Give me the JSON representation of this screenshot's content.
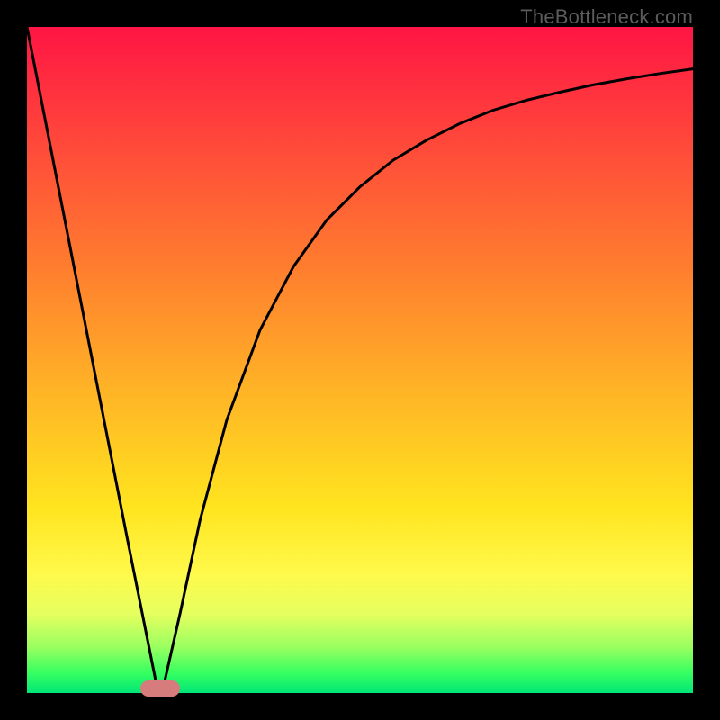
{
  "watermark": "TheBottleneck.com",
  "chart_data": {
    "type": "line",
    "title": "",
    "xlabel": "",
    "ylabel": "",
    "xlim": [
      0,
      1
    ],
    "ylim": [
      0,
      1
    ],
    "grid": false,
    "legend": false,
    "background_gradient": {
      "direction": "vertical",
      "stops": [
        {
          "pos": 0.0,
          "color": "#ff1544"
        },
        {
          "pos": 0.18,
          "color": "#ff4a3a"
        },
        {
          "pos": 0.35,
          "color": "#ff7a2f"
        },
        {
          "pos": 0.55,
          "color": "#ffb526"
        },
        {
          "pos": 0.72,
          "color": "#ffe41f"
        },
        {
          "pos": 0.82,
          "color": "#fff94a"
        },
        {
          "pos": 0.88,
          "color": "#e6ff5f"
        },
        {
          "pos": 0.93,
          "color": "#9cff60"
        },
        {
          "pos": 0.97,
          "color": "#36ff60"
        },
        {
          "pos": 1.0,
          "color": "#00e676"
        }
      ]
    },
    "series": [
      {
        "name": "bottleneck-curve",
        "x": [
          0.0,
          0.05,
          0.1,
          0.15,
          0.195,
          0.205,
          0.23,
          0.26,
          0.3,
          0.35,
          0.4,
          0.45,
          0.5,
          0.55,
          0.6,
          0.65,
          0.7,
          0.75,
          0.8,
          0.85,
          0.9,
          0.95,
          1.0
        ],
        "values": [
          1.0,
          0.745,
          0.49,
          0.235,
          0.01,
          0.01,
          0.12,
          0.26,
          0.41,
          0.545,
          0.64,
          0.71,
          0.76,
          0.8,
          0.83,
          0.855,
          0.875,
          0.89,
          0.902,
          0.913,
          0.922,
          0.93,
          0.937
        ]
      }
    ],
    "marker": {
      "name": "optimal-point",
      "x": 0.2,
      "y": 0.0,
      "color": "#d77c7c"
    }
  }
}
